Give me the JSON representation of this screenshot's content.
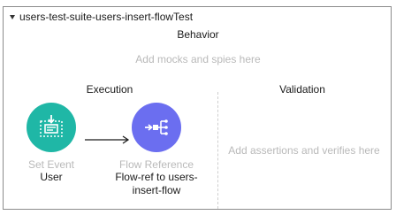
{
  "test": {
    "title": "users-test-suite-users-insert-flowTest"
  },
  "behavior": {
    "label": "Behavior",
    "placeholder": "Add mocks and spies here"
  },
  "execution": {
    "label": "Execution",
    "nodes": [
      {
        "type_label": "Set Event",
        "name": "User",
        "icon": "set-event-icon",
        "color": "#1fb7a6"
      },
      {
        "type_label": "Flow Reference",
        "name_line1": "Flow-ref to users-",
        "name_line2": "insert-flow",
        "icon": "flow-reference-icon",
        "color": "#6b6ef0"
      }
    ]
  },
  "validation": {
    "label": "Validation",
    "placeholder": "Add assertions and verifies here"
  }
}
